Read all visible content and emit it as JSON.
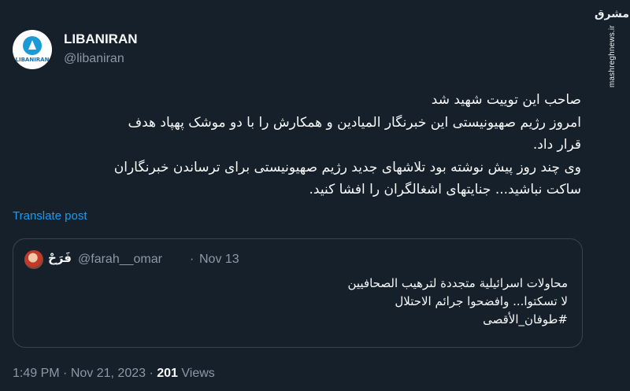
{
  "author": {
    "avatar_logo_text": "LIBANIRAN",
    "display_name": "LIBANIRAN",
    "handle": "@libaniran"
  },
  "tweet": {
    "lines": [
      "صاحب این توییت شهید شد",
      "امروز رژیم صهیونیستی این خبرنگار المیادین و همکارش را با دو موشک پهپاد هدف",
      "قرار داد.",
      "وی چند روز پیش نوشته بود تلاشهای جدید رژیم صهیونیستی برای ترساندن خبرنگاران",
      "ساکت نباشید... جنایتهای اشغالگران را افشا کنید."
    ],
    "translate_label": "Translate post"
  },
  "quote": {
    "display_name": "فَرَحْ",
    "handle": "@farah__omar",
    "separator": "·",
    "date": "Nov 13",
    "lines": [
      "محاولات اسرائيلية متجددة لترهيب الصحافيين",
      "لا تسكتوا... وافضحوا جرائم الاحتلال",
      "#طوفان_الأقصى"
    ]
  },
  "footer": {
    "time": "1:49 PM",
    "separator": "·",
    "date": "Nov 21, 2023",
    "views_count": "201",
    "views_label": "Views"
  },
  "watermark": {
    "logo": "مشرق",
    "url": "mashreghnews.ir"
  },
  "colors": {
    "background": "#15202b",
    "text": "#f7f9f9",
    "muted": "#8b98a5",
    "link": "#1d9bf0",
    "border": "#38444d"
  }
}
